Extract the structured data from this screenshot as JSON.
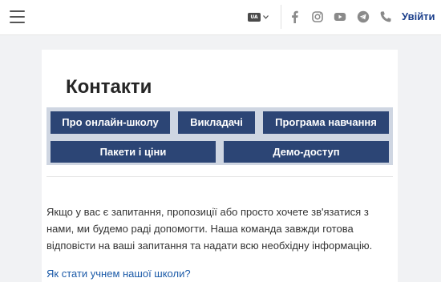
{
  "header": {
    "menu_icon": "hamburger-menu-icon",
    "language_icon": "language-icon",
    "language_code": "UA",
    "social_icons": [
      "facebook-icon",
      "instagram-icon",
      "youtube-icon",
      "telegram-icon",
      "phone-icon"
    ],
    "login_label": "Увійти"
  },
  "main": {
    "title": "Контакти",
    "nav_buttons": [
      "Про онлайн-школу",
      "Викладачі",
      "Програма навчання",
      "Пакети і ціни",
      "Демо-доступ"
    ],
    "intro_text": "Якщо у вас є запитання, пропозиції або просто хочете зв'язатися з нами, ми будемо раді допомогти. Наша команда завжди готова відповісти на ваші запитання та надати всю необхідну інформацію.",
    "faq_link": "Як стати учнем нашої школи?"
  },
  "colors": {
    "accent": "#2c4575",
    "link": "#1b5aa8",
    "login": "#1b3f8b",
    "page_background": "#f1f2f4"
  }
}
